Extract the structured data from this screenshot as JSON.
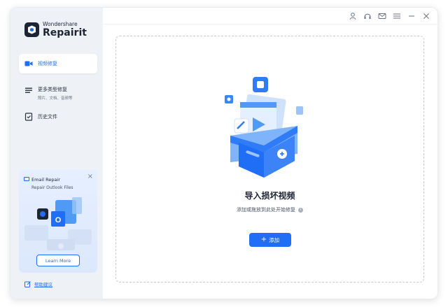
{
  "app": {
    "brand_small": "Wondershare",
    "brand_big": "Repairit"
  },
  "sidebar": {
    "items": [
      {
        "label": "视频修复",
        "icon": "video-icon",
        "active": true
      },
      {
        "label": "更多类型修复",
        "sublabel": "照片、文档、音频等",
        "icon": "list-icon",
        "active": false
      },
      {
        "label": "历史文件",
        "icon": "history-icon",
        "active": false
      }
    ],
    "promo": {
      "title": "Email Repair",
      "subtitle": "Repair Outlook Files",
      "button": "Learn More",
      "close": "×"
    },
    "feedback": "帮助建议"
  },
  "titlebar": {
    "icons": [
      "user-icon",
      "headset-icon",
      "mail-icon",
      "menu-icon",
      "minimize-icon",
      "close-icon"
    ]
  },
  "main": {
    "title": "导入损坏视频",
    "subtitle": "添加或拖放到此处开始修复",
    "add_button": "添加",
    "info": "i"
  },
  "colors": {
    "accent": "#1f6ef5",
    "sidebar_bg": "#eef2f7",
    "text_dark": "#1d2433"
  }
}
